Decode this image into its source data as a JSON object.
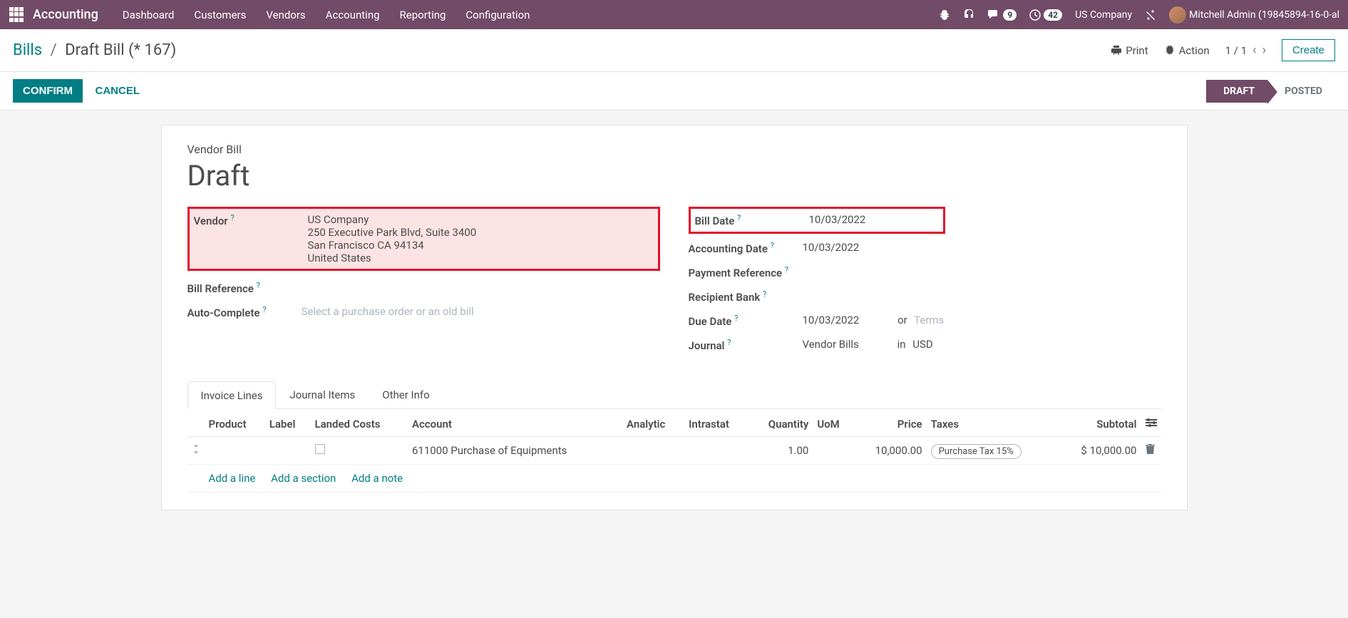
{
  "navbar": {
    "brand": "Accounting",
    "links": [
      "Dashboard",
      "Customers",
      "Vendors",
      "Accounting",
      "Reporting",
      "Configuration"
    ],
    "messages_badge": "9",
    "activity_badge": "42",
    "company": "US Company",
    "user": "Mitchell Admin (19845894-16-0-al"
  },
  "breadcrumb": {
    "root": "Bills",
    "current": "Draft Bill (* 167)"
  },
  "controls": {
    "print": "Print",
    "action": "Action",
    "pager": "1 / 1",
    "create": "Create"
  },
  "status": {
    "confirm": "CONFIRM",
    "cancel": "CANCEL",
    "draft": "DRAFT",
    "posted": "POSTED"
  },
  "form": {
    "title_label": "Vendor Bill",
    "title_value": "Draft",
    "left": {
      "vendor_label": "Vendor",
      "vendor_name": "US Company",
      "vendor_addr1": "250 Executive Park Blvd, Suite 3400",
      "vendor_addr2": "San Francisco CA 94134",
      "vendor_addr3": "United States",
      "bill_ref_label": "Bill Reference",
      "auto_label": "Auto-Complete",
      "auto_placeholder": "Select a purchase order or an old bill"
    },
    "right": {
      "bill_date_label": "Bill Date",
      "bill_date_value": "10/03/2022",
      "acc_date_label": "Accounting Date",
      "acc_date_value": "10/03/2022",
      "pay_ref_label": "Payment Reference",
      "bank_label": "Recipient Bank",
      "due_label": "Due Date",
      "due_value": "10/03/2022",
      "due_or": "or",
      "due_terms": "Terms",
      "journal_label": "Journal",
      "journal_value": "Vendor Bills",
      "journal_in": "in",
      "journal_cur": "USD"
    }
  },
  "tabs": {
    "t1": "Invoice Lines",
    "t2": "Journal Items",
    "t3": "Other Info"
  },
  "table": {
    "headers": {
      "product": "Product",
      "label": "Label",
      "landed": "Landed Costs",
      "account": "Account",
      "analytic": "Analytic",
      "intrastat": "Intrastat",
      "qty": "Quantity",
      "uom": "UoM",
      "price": "Price",
      "taxes": "Taxes",
      "subtotal": "Subtotal"
    },
    "row": {
      "account": "611000 Purchase of Equipments",
      "qty": "1.00",
      "price": "10,000.00",
      "tax": "Purchase Tax 15%",
      "subtotal": "$ 10,000.00"
    },
    "add_line": "Add a line",
    "add_section": "Add a section",
    "add_note": "Add a note"
  }
}
